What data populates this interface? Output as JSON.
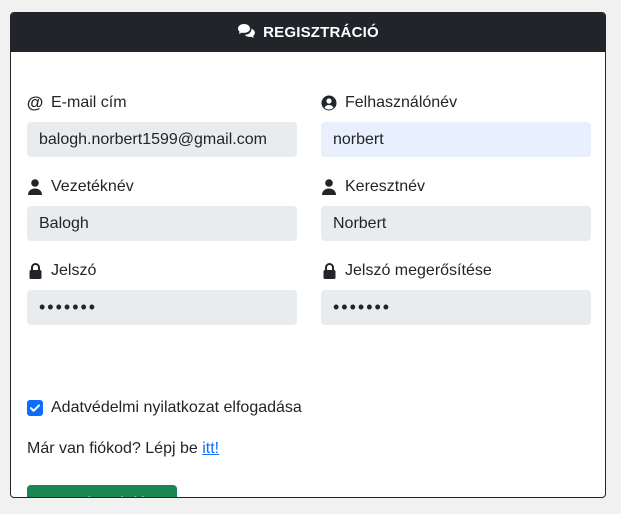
{
  "header": {
    "title": "REGISZTRÁCIÓ",
    "icon": "comments-icon"
  },
  "fields": {
    "email": {
      "label": "E-mail cím",
      "value": "balogh.norbert1599@gmail.com",
      "icon": "at-icon"
    },
    "username": {
      "label": "Felhasználónév",
      "value": "norbert",
      "icon": "user-circle-icon"
    },
    "lastname": {
      "label": "Vezetéknév",
      "value": "Balogh",
      "icon": "user-icon"
    },
    "firstname": {
      "label": "Keresztnév",
      "value": "Norbert",
      "icon": "user-icon"
    },
    "password": {
      "label": "Jelszó",
      "value": "•••••••",
      "icon": "lock-icon"
    },
    "password_confirm": {
      "label": "Jelszó megerősítése",
      "value": "•••••••",
      "icon": "lock-icon"
    }
  },
  "privacy": {
    "label": "Adatvédelmi nyilatkozat elfogadása",
    "checked": true
  },
  "login_prompt": {
    "text": "Már van fiókod? Lépj be ",
    "link": "itt!"
  },
  "submit_label": "Regisztráció",
  "colors": {
    "header_bg": "#212529",
    "input_bg": "#e9ecef",
    "input_active_bg": "#e8f0fe",
    "button_bg": "#198754",
    "link": "#0d6efd"
  }
}
